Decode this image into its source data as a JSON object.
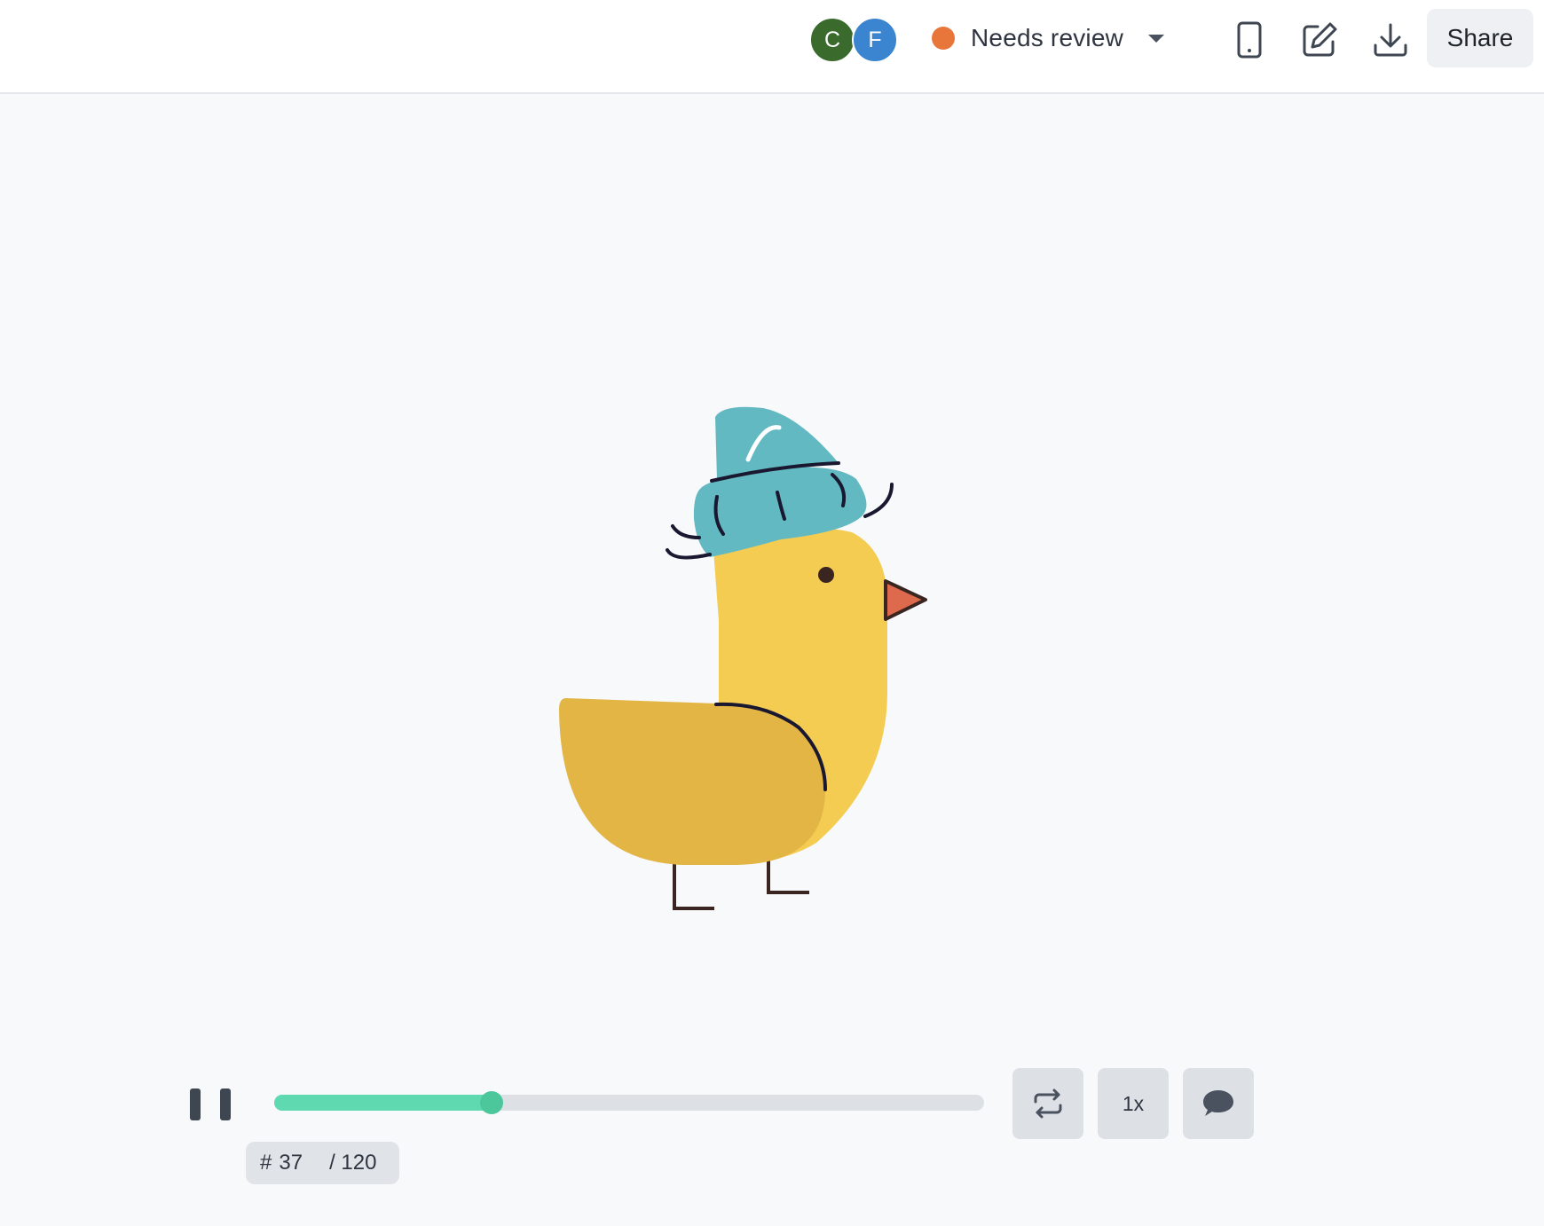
{
  "header": {
    "collaborators": [
      {
        "initial": "C",
        "color": "#3a6a2c"
      },
      {
        "initial": "F",
        "color": "#3b84cf"
      }
    ],
    "status": {
      "label": "Needs review",
      "color": "#e8763a"
    },
    "icons": [
      "mobile-preview-icon",
      "edit-icon",
      "download-icon"
    ],
    "share_label": "Share"
  },
  "animation": {
    "description_icon": "duck-with-beanie",
    "colors": {
      "body": "#f5cc52",
      "wing": "#e2b545",
      "hat": "#63b9c1",
      "beak": "#dd6a4c",
      "outline": "#2a1d1a"
    }
  },
  "player": {
    "state": "playing",
    "progress": 0.306,
    "frame_hash": "#",
    "current_frame": "37",
    "total_frames": "/ 120",
    "loop_icon": "loop-icon",
    "speed_label": "1x",
    "comment_icon": "comment-icon",
    "accent": "#5fd9b0"
  }
}
